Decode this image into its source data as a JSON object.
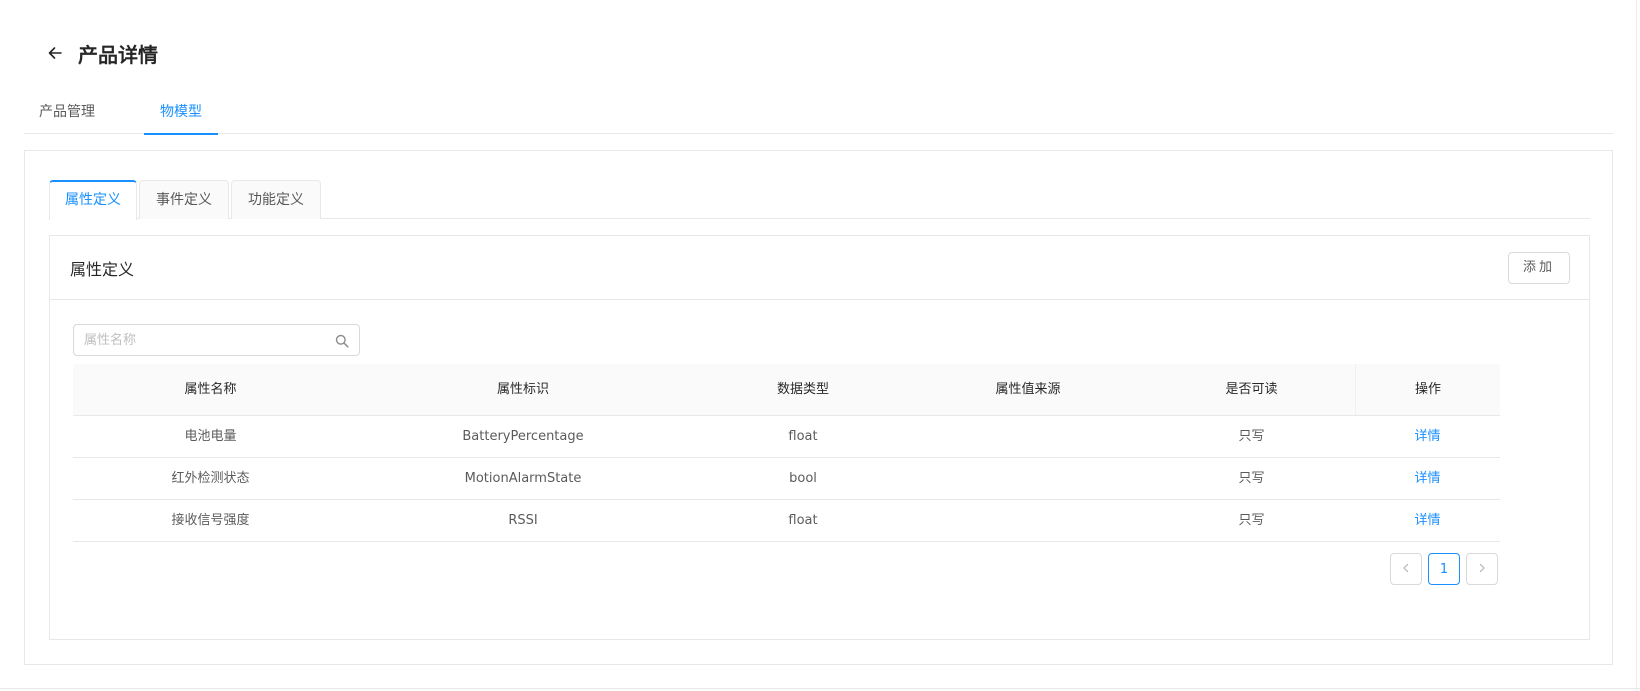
{
  "header": {
    "title": "产品详情",
    "back_icon": "arrow-left-icon"
  },
  "top_tabs": [
    {
      "label": "产品管理",
      "active": false
    },
    {
      "label": "物模型",
      "active": true
    }
  ],
  "card_tabs": [
    {
      "label": "属性定义",
      "active": true
    },
    {
      "label": "事件定义",
      "active": false
    },
    {
      "label": "功能定义",
      "active": false
    }
  ],
  "panel": {
    "title": "属性定义",
    "add_label": "添加"
  },
  "search": {
    "placeholder": "属性名称",
    "value": ""
  },
  "table": {
    "columns": [
      "属性名称",
      "属性标识",
      "数据类型",
      "属性值来源",
      "是否可读",
      "操作"
    ],
    "rows": [
      {
        "name": "电池电量",
        "identifier": "BatteryPercentage",
        "type": "float",
        "source": "",
        "readable": "只写",
        "action": "详情"
      },
      {
        "name": "红外检测状态",
        "identifier": "MotionAlarmState",
        "type": "bool",
        "source": "",
        "readable": "只写",
        "action": "详情"
      },
      {
        "name": "接收信号强度",
        "identifier": "RSSI",
        "type": "float",
        "source": "",
        "readable": "只写",
        "action": "详情"
      }
    ]
  },
  "pagination": {
    "current_page": "1",
    "prev_icon": "chevron-left-icon",
    "next_icon": "chevron-right-icon"
  },
  "colors": {
    "accent": "#1890ff",
    "border": "#e8e8e8",
    "header_bg": "#fafafa"
  }
}
